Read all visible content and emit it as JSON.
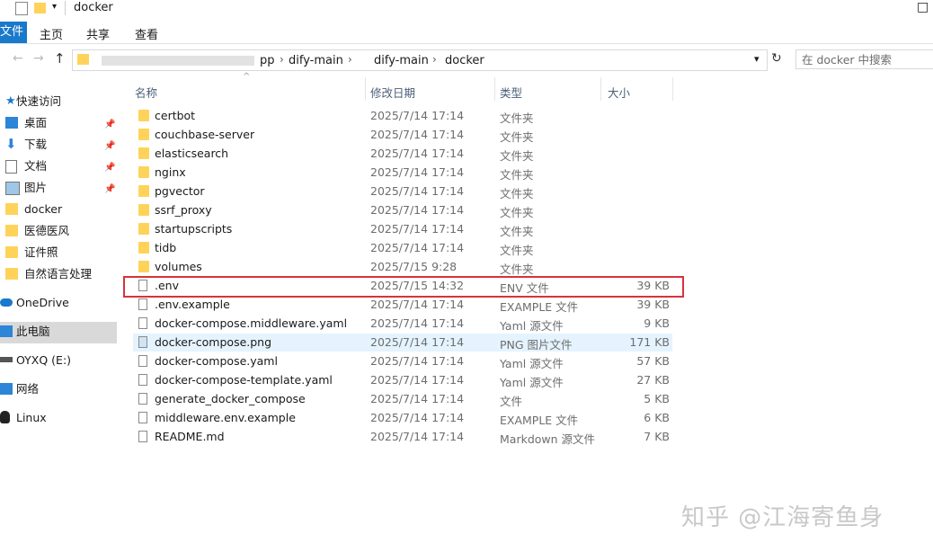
{
  "window": {
    "title": "docker",
    "close_glyph": "×",
    "maximize_glyph": "□",
    "minimize_glyph": "—"
  },
  "ribbon": {
    "file_tab": "文件",
    "tabs": [
      "主页",
      "共享",
      "查看"
    ]
  },
  "address": {
    "breadcrumbs": [
      "pp",
      "dify-main",
      "dify-main",
      "docker"
    ],
    "search_placeholder": "在 docker 中搜索"
  },
  "nav": {
    "items": [
      {
        "label": "快速访问",
        "icon": "star-icon",
        "pinned": false
      },
      {
        "label": "桌面",
        "icon": "desktop-icon",
        "pinned": true
      },
      {
        "label": "下载",
        "icon": "download-icon",
        "pinned": true
      },
      {
        "label": "文档",
        "icon": "document-icon",
        "pinned": true
      },
      {
        "label": "图片",
        "icon": "pictures-icon",
        "pinned": true
      },
      {
        "label": "docker",
        "icon": "folder-icon",
        "pinned": false
      },
      {
        "label": "医德医风",
        "icon": "folder-icon",
        "pinned": false
      },
      {
        "label": "证件照",
        "icon": "folder-icon",
        "pinned": false
      },
      {
        "label": "自然语言处理",
        "icon": "folder-icon",
        "pinned": false
      },
      {
        "label": "OneDrive",
        "icon": "cloud-icon",
        "pinned": false
      },
      {
        "label": "此电脑",
        "icon": "computer-icon",
        "pinned": false,
        "selected": true
      },
      {
        "label": "OYXQ (E:)",
        "icon": "drive-icon",
        "pinned": false
      },
      {
        "label": "网络",
        "icon": "network-icon",
        "pinned": false
      },
      {
        "label": "Linux",
        "icon": "linux-icon",
        "pinned": false
      }
    ]
  },
  "columns": {
    "name": "名称",
    "modified": "修改日期",
    "type": "类型",
    "size": "大小"
  },
  "files": [
    {
      "name": "certbot",
      "modified": "2025/7/14 17:14",
      "type": "文件夹",
      "size": "",
      "icon": "folder-icon"
    },
    {
      "name": "couchbase-server",
      "modified": "2025/7/14 17:14",
      "type": "文件夹",
      "size": "",
      "icon": "folder-icon"
    },
    {
      "name": "elasticsearch",
      "modified": "2025/7/14 17:14",
      "type": "文件夹",
      "size": "",
      "icon": "folder-icon"
    },
    {
      "name": "nginx",
      "modified": "2025/7/14 17:14",
      "type": "文件夹",
      "size": "",
      "icon": "folder-icon"
    },
    {
      "name": "pgvector",
      "modified": "2025/7/14 17:14",
      "type": "文件夹",
      "size": "",
      "icon": "folder-icon"
    },
    {
      "name": "ssrf_proxy",
      "modified": "2025/7/14 17:14",
      "type": "文件夹",
      "size": "",
      "icon": "folder-icon"
    },
    {
      "name": "startupscripts",
      "modified": "2025/7/14 17:14",
      "type": "文件夹",
      "size": "",
      "icon": "folder-icon"
    },
    {
      "name": "tidb",
      "modified": "2025/7/14 17:14",
      "type": "文件夹",
      "size": "",
      "icon": "folder-icon"
    },
    {
      "name": "volumes",
      "modified": "2025/7/15 9:28",
      "type": "文件夹",
      "size": "",
      "icon": "folder-icon"
    },
    {
      "name": ".env",
      "modified": "2025/7/15 14:32",
      "type": "ENV 文件",
      "size": "39 KB",
      "icon": "file-icon",
      "highlighted": true
    },
    {
      "name": ".env.example",
      "modified": "2025/7/14 17:14",
      "type": "EXAMPLE 文件",
      "size": "39 KB",
      "icon": "file-icon"
    },
    {
      "name": "docker-compose.middleware.yaml",
      "modified": "2025/7/14 17:14",
      "type": "Yaml 源文件",
      "size": "9 KB",
      "icon": "yaml-file-icon"
    },
    {
      "name": "docker-compose.png",
      "modified": "2025/7/14 17:14",
      "type": "PNG 图片文件",
      "size": "171 KB",
      "icon": "image-file-icon",
      "selected": true
    },
    {
      "name": "docker-compose.yaml",
      "modified": "2025/7/14 17:14",
      "type": "Yaml 源文件",
      "size": "57 KB",
      "icon": "yaml-file-icon"
    },
    {
      "name": "docker-compose-template.yaml",
      "modified": "2025/7/14 17:14",
      "type": "Yaml 源文件",
      "size": "27 KB",
      "icon": "yaml-file-icon"
    },
    {
      "name": "generate_docker_compose",
      "modified": "2025/7/14 17:14",
      "type": "文件",
      "size": "5 KB",
      "icon": "file-icon"
    },
    {
      "name": "middleware.env.example",
      "modified": "2025/7/14 17:14",
      "type": "EXAMPLE 文件",
      "size": "6 KB",
      "icon": "file-icon"
    },
    {
      "name": "README.md",
      "modified": "2025/7/14 17:14",
      "type": "Markdown 源文件",
      "size": "7 KB",
      "icon": "markdown-file-icon"
    }
  ],
  "watermark": "知乎 @江海寄鱼身",
  "colors": {
    "accent": "#1979ca",
    "selection": "#e5f3ff",
    "highlight_border": "#d8333a",
    "folder": "#ffd35a"
  }
}
